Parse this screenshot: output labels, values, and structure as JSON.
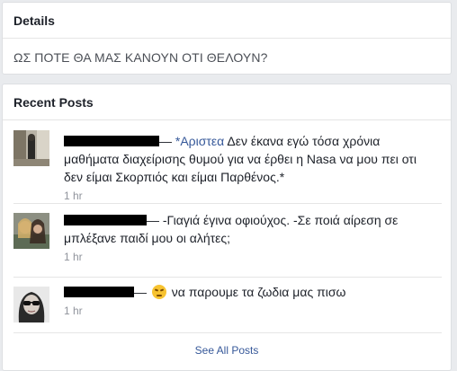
{
  "details": {
    "title": "Details",
    "text": "ΩΣ ΠΟΤΕ ΘΑ ΜΑΣ ΚΑΝΟΥΝ ΟΤΙ ΘΕΛΟΥΝ?"
  },
  "recent_posts": {
    "title": "Recent Posts",
    "see_all": "See All Posts",
    "posts": [
      {
        "dash": "—",
        "link": "*Αριστεα",
        "text": " Δεν έκανα εγώ τόσα χρόνια μαθήματα διαχείρισης θυμού για να έρθει η Nasa να μου πει οτι δεν είμαι Σκορπιός και είμαι Παρθένος.*",
        "time": "1 hr"
      },
      {
        "dash": "—",
        "text": " -Γιαγιά έγινα οφιούχος. -Σε ποιά αίρεση σε μπλέξανε παιδί μου οι αλήτες;",
        "time": "1 hr"
      },
      {
        "dash": "—",
        "text": " να παρουμε τα ζωδια μας πισω",
        "time": "1 hr"
      }
    ]
  }
}
